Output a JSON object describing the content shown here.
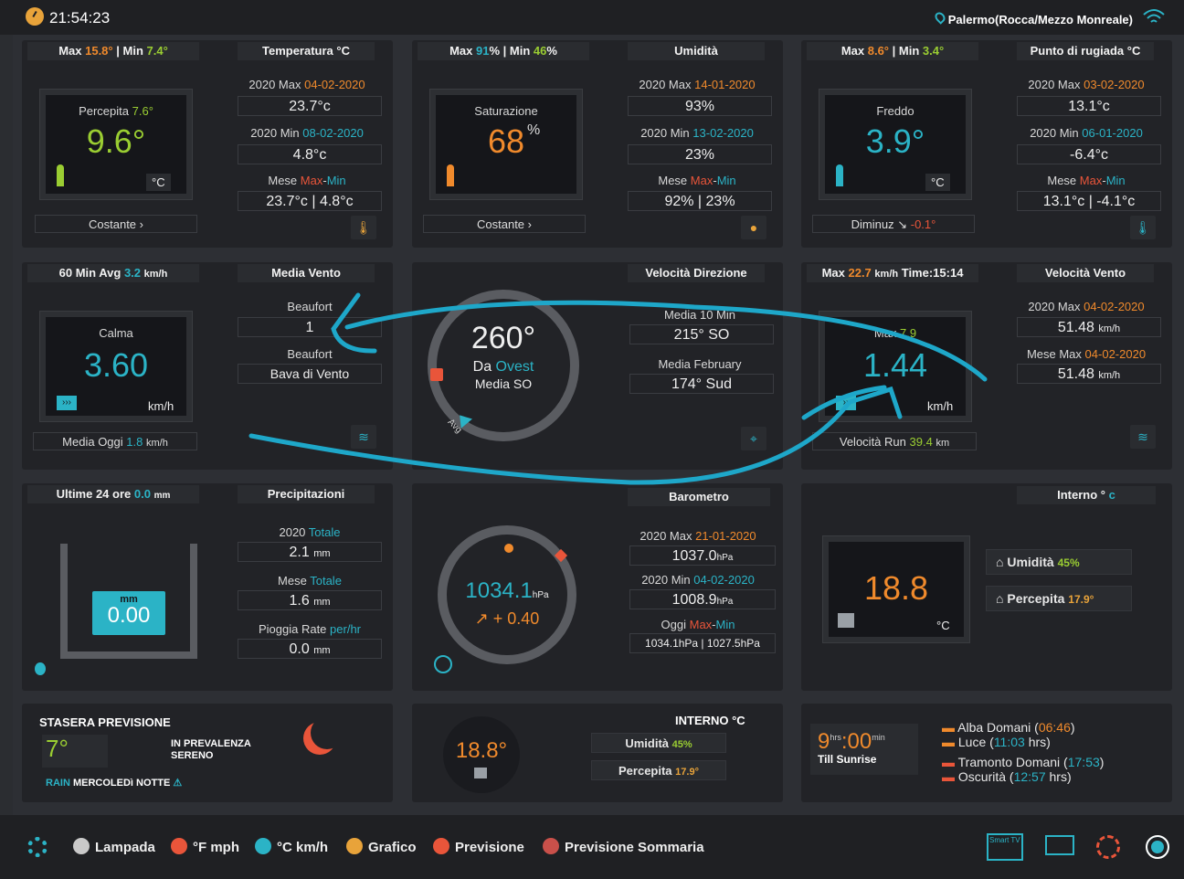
{
  "top": {
    "time": "21:54:23",
    "location": "Palermo(Rocca/Mezzo Monreale)"
  },
  "temp": {
    "max_label": "Max",
    "max_val": "15.8°",
    "min_label": "Min",
    "min_val": "7.4°",
    "title": "Temperatura °C",
    "feels_label": "Percepita",
    "feels_val": "7.6°",
    "value": "9.6°",
    "unit": "°C",
    "year_max_label": "2020 Max",
    "year_max_date": "04-02-2020",
    "year_max_val": "23.7°c",
    "year_min_label": "2020 Min",
    "year_min_date": "08-02-2020",
    "year_min_val": "4.8°c",
    "month_label": "Mese",
    "month_max": "Max",
    "month_min": "Min",
    "month_val": "23.7°c | 4.8°c",
    "trend": "Costante ›"
  },
  "hum": {
    "max_label": "Max",
    "max_val": "91",
    "min_label": "Min",
    "min_val": "46",
    "title": "Umidità",
    "sat_label": "Saturazione",
    "unit": "%",
    "value": "68",
    "year_max_label": "2020 Max",
    "year_max_date": "14-01-2020",
    "year_max_val": "93%",
    "year_min_label": "2020 Min",
    "year_min_date": "13-02-2020",
    "year_min_val": "23%",
    "month_label": "Mese",
    "month_max": "Max",
    "month_min": "Min",
    "month_val": "92% | 23%",
    "trend": "Costante ›"
  },
  "dew": {
    "max_label": "Max",
    "max_val": "8.6°",
    "min_label": "Min",
    "min_val": "3.4°",
    "title": "Punto di rugiada °C",
    "feel_label": "Freddo",
    "value": "3.9°",
    "unit": "°C",
    "year_max_label": "2020 Max",
    "year_max_date": "03-02-2020",
    "year_max_val": "13.1°c",
    "year_min_label": "2020 Min",
    "year_min_date": "06-01-2020",
    "year_min_val": "-6.4°c",
    "month_label": "Mese",
    "month_max": "Max",
    "month_min": "Min",
    "month_val": "13.1°c | -4.1°c",
    "trend_label": "Diminuz",
    "trend_val": "-0.1°"
  },
  "wind_avg": {
    "hdr_label": "60 Min Avg",
    "hdr_val": "3.2",
    "hdr_unit": "km/h",
    "title": "Media Vento",
    "state": "Calma",
    "value": "3.60",
    "unit": "km/h",
    "beaufort_label": "Beaufort",
    "beaufort_val": "1",
    "beaufort_label2": "Beaufort",
    "beaufort_desc": "Bava di Vento",
    "today_label": "Media Oggi",
    "today_val": "1.8",
    "today_unit": "km/h"
  },
  "wind_dir": {
    "title": "Velocità Direzione",
    "degrees": "260°",
    "from_label": "Da",
    "from_dir": "Ovest",
    "avg_dir": "Media SO",
    "avg_tag": "Avg",
    "m10_label": "Media 10 Min",
    "m10_val": "215°  SO",
    "month_label": "Media February",
    "month_val": "174°  Sud"
  },
  "wind_speed": {
    "hdr_label": "Max",
    "hdr_val": "22.7",
    "hdr_unit": "km/h",
    "hdr_time": "Time:15:14",
    "title": "Velocità Vento",
    "gust_label": "Max",
    "gust_val": "7.9",
    "value": "1.44",
    "unit": "km/h",
    "year_max_label": "2020 Max",
    "year_max_date": "04-02-2020",
    "year_max_val": "51.48",
    "year_max_unit": "km/h",
    "month_max_label": "Mese Max",
    "month_max_date": "04-02-2020",
    "month_max_val": "51.48",
    "month_max_unit": "km/h",
    "run_label": "Velocità Run",
    "run_val": "39.4",
    "run_unit": "km"
  },
  "rain": {
    "hdr_label": "Ultime 24 ore",
    "hdr_val": "0.0",
    "hdr_unit": "mm",
    "title": "Precipitazioni",
    "gauge_unit": "mm",
    "gauge_val": "0.00",
    "year_label": "2020",
    "year_tag": "Totale",
    "year_val": "2.1",
    "year_unit": "mm",
    "month_label": "Mese",
    "month_tag": "Totale",
    "month_val": "1.6",
    "month_unit": "mm",
    "rate_label": "Pioggia Rate",
    "rate_tag": "per/hr",
    "rate_val": "0.0",
    "rate_unit": "mm"
  },
  "baro": {
    "title": "Barometro",
    "value": "1034.1",
    "unit": "hPa",
    "trend": "+ 0.40",
    "year_max_label": "2020 Max",
    "year_max_date": "21-01-2020",
    "year_max_val": "1037.0",
    "year_max_unit": "hPa",
    "year_min_label": "2020 Min",
    "year_min_date": "04-02-2020",
    "year_min_val": "1008.9",
    "year_min_unit": "hPa",
    "today_label": "Oggi",
    "today_max": "Max",
    "today_min": "Min",
    "today_val": "1034.1hPa  |  1027.5hPa"
  },
  "indoor": {
    "title": "Interno °",
    "title_unit": "c",
    "value": "18.8",
    "unit": "°C",
    "hum_label": "Umidità",
    "hum_val": "45%",
    "feels_label": "Percepita",
    "feels_val": "17.9°"
  },
  "forecast": {
    "title": "STASERA PREVISIONE",
    "temp": "7°",
    "desc1": "IN PREVALENZA",
    "desc2": "SERENO",
    "rain_label": "RAIN",
    "day": "MERCOLEDì NOTTE"
  },
  "indoor2": {
    "title": "INTERNO °C",
    "value": "18.8°",
    "hum_label": "Umidità",
    "hum_val": "45%",
    "feels_label": "Percepita",
    "feels_val": "17.9°"
  },
  "sun": {
    "hours": "9",
    "hrs_label": "hrs",
    "sep": ":",
    "mins": "00",
    "min_label": "min",
    "till": "Till Sunrise",
    "sunrise_label": "Alba Domani",
    "sunrise_val": "06:46",
    "light_label": "Luce",
    "light_val": "11:03",
    "light_unit": "hrs",
    "sunset_label": "Tramonto Domani",
    "sunset_val": "17:53",
    "dark_label": "Oscurità",
    "dark_val": "12:57",
    "dark_unit": "hrs"
  },
  "footer": {
    "items": [
      {
        "label": "Lampada",
        "color": "#c9c9c9"
      },
      {
        "label": "°F mph",
        "color": "#e9553a"
      },
      {
        "label": "°C km/h",
        "color": "#2bb3c6"
      },
      {
        "label": "Grafico",
        "color": "#e8a33a"
      },
      {
        "label": "Previsione",
        "color": "#e9553a"
      },
      {
        "label": "Previsione Sommaria",
        "color": "#c9504a"
      }
    ],
    "tv_label": "Smart TV"
  },
  "colors": {
    "accent_teal": "#2bb3c6",
    "accent_orange": "#f08a2c",
    "accent_green": "#9acd32",
    "annotation": "#1ea7c9"
  }
}
